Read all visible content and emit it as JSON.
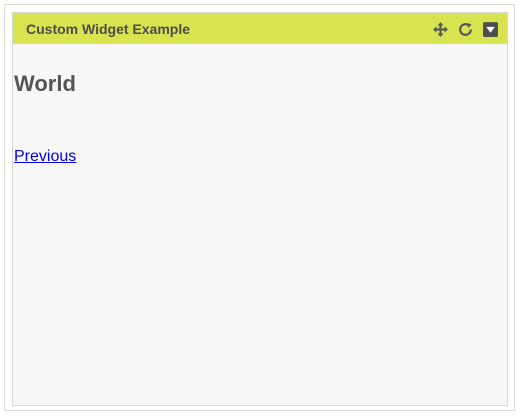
{
  "widget": {
    "title": "Custom Widget Example",
    "header_color": "#d7e34f",
    "icons": [
      "move-icon",
      "refresh-icon",
      "collapse-icon"
    ]
  },
  "content": {
    "heading": "World",
    "link_label": "Previous"
  }
}
